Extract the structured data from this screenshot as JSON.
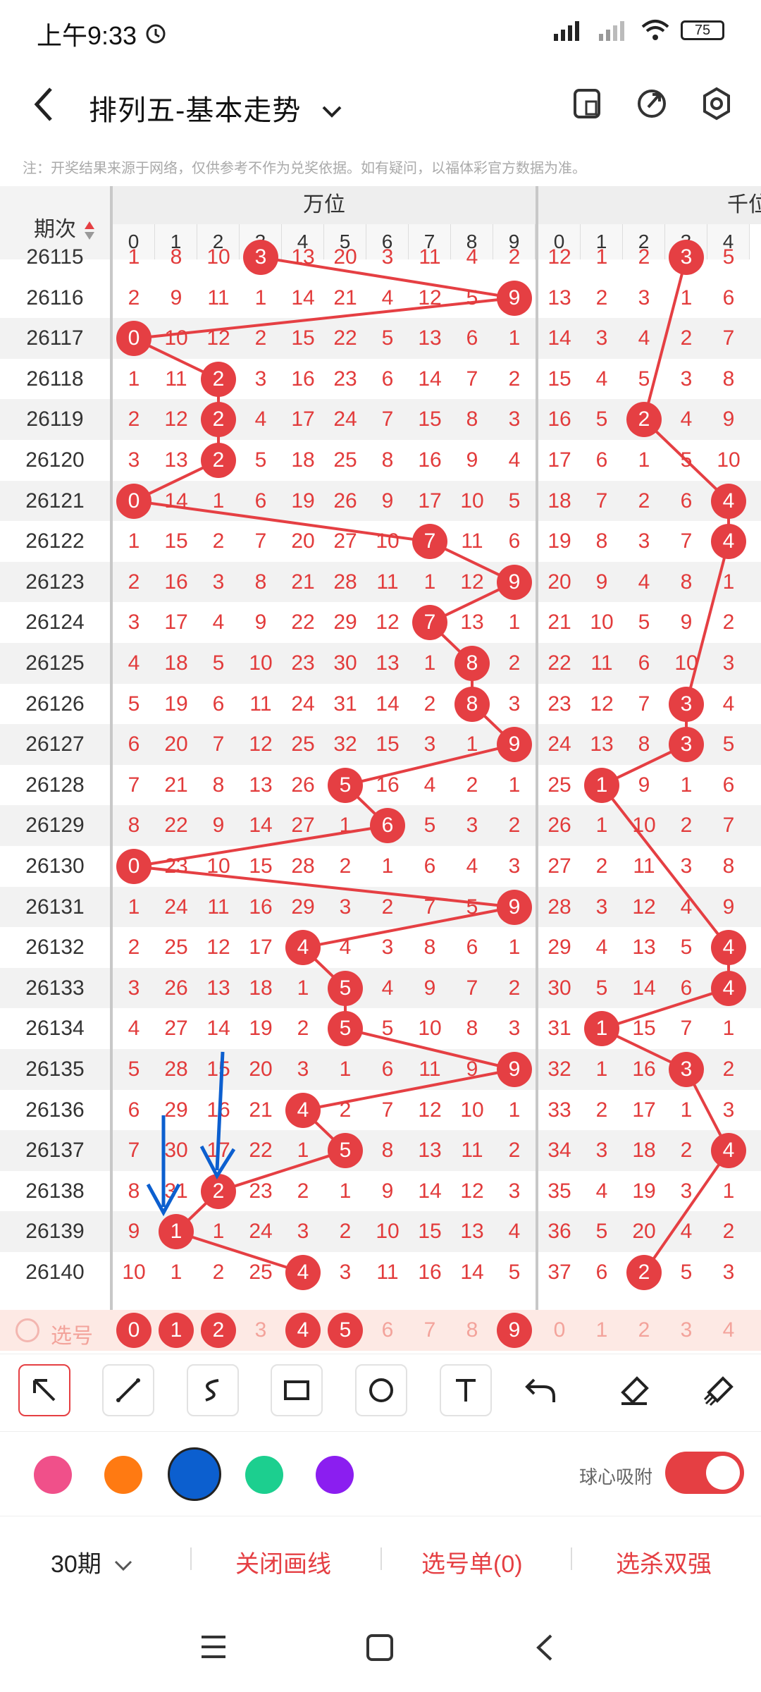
{
  "status_bar": {
    "time": "上午9:33",
    "battery": "75"
  },
  "header": {
    "title": "排列五-基本走势"
  },
  "note": "注：开奖结果来源于网络，仅供参考不作为兑奖依据。如有疑问，以福体彩官方数据为准。",
  "table": {
    "col_period": "期次",
    "group_wan": "万位",
    "group_qian": "千位",
    "digits": [
      "0",
      "1",
      "2",
      "3",
      "4",
      "5",
      "6",
      "7",
      "8",
      "9"
    ],
    "qian_digits": [
      "0",
      "1",
      "2",
      "3",
      "4"
    ],
    "rows": [
      {
        "period": "26115",
        "wan": [
          "1",
          "8",
          "10",
          "3",
          "13",
          "20",
          "3",
          "11",
          "4",
          "2"
        ],
        "wan_hit": 3,
        "qian": [
          "12",
          "1",
          "2",
          "3",
          "5"
        ],
        "qian_hit": 3
      },
      {
        "period": "26116",
        "wan": [
          "2",
          "9",
          "11",
          "1",
          "14",
          "21",
          "4",
          "12",
          "5",
          "9"
        ],
        "wan_hit": 9,
        "qian": [
          "13",
          "2",
          "3",
          "1",
          "6"
        ],
        "qian_hit": -1
      },
      {
        "period": "26117",
        "wan": [
          "0",
          "10",
          "12",
          "2",
          "15",
          "22",
          "5",
          "13",
          "6",
          "1"
        ],
        "wan_hit": 0,
        "qian": [
          "14",
          "3",
          "4",
          "2",
          "7"
        ],
        "qian_hit": -1
      },
      {
        "period": "26118",
        "wan": [
          "1",
          "11",
          "2",
          "3",
          "16",
          "23",
          "6",
          "14",
          "7",
          "2"
        ],
        "wan_hit": 2,
        "qian": [
          "15",
          "4",
          "5",
          "3",
          "8"
        ],
        "qian_hit": -1
      },
      {
        "period": "26119",
        "wan": [
          "2",
          "12",
          "2",
          "4",
          "17",
          "24",
          "7",
          "15",
          "8",
          "3"
        ],
        "wan_hit": 2,
        "qian": [
          "16",
          "5",
          "2",
          "4",
          "9"
        ],
        "qian_hit": 2
      },
      {
        "period": "26120",
        "wan": [
          "3",
          "13",
          "2",
          "5",
          "18",
          "25",
          "8",
          "16",
          "9",
          "4"
        ],
        "wan_hit": 2,
        "qian": [
          "17",
          "6",
          "1",
          "5",
          "10"
        ],
        "qian_hit": -1
      },
      {
        "period": "26121",
        "wan": [
          "0",
          "14",
          "1",
          "6",
          "19",
          "26",
          "9",
          "17",
          "10",
          "5"
        ],
        "wan_hit": 0,
        "qian": [
          "18",
          "7",
          "2",
          "6",
          "4"
        ],
        "qian_hit": 4
      },
      {
        "period": "26122",
        "wan": [
          "1",
          "15",
          "2",
          "7",
          "20",
          "27",
          "10",
          "7",
          "11",
          "6"
        ],
        "wan_hit": 7,
        "qian": [
          "19",
          "8",
          "3",
          "7",
          "4"
        ],
        "qian_hit": 4
      },
      {
        "period": "26123",
        "wan": [
          "2",
          "16",
          "3",
          "8",
          "21",
          "28",
          "11",
          "1",
          "12",
          "9"
        ],
        "wan_hit": 9,
        "qian": [
          "20",
          "9",
          "4",
          "8",
          "1"
        ],
        "qian_hit": -1
      },
      {
        "period": "26124",
        "wan": [
          "3",
          "17",
          "4",
          "9",
          "22",
          "29",
          "12",
          "7",
          "13",
          "1"
        ],
        "wan_hit": 7,
        "qian": [
          "21",
          "10",
          "5",
          "9",
          "2"
        ],
        "qian_hit": -1
      },
      {
        "period": "26125",
        "wan": [
          "4",
          "18",
          "5",
          "10",
          "23",
          "30",
          "13",
          "1",
          "8",
          "2"
        ],
        "wan_hit": 8,
        "qian": [
          "22",
          "11",
          "6",
          "10",
          "3"
        ],
        "qian_hit": -1
      },
      {
        "period": "26126",
        "wan": [
          "5",
          "19",
          "6",
          "11",
          "24",
          "31",
          "14",
          "2",
          "8",
          "3"
        ],
        "wan_hit": 8,
        "qian": [
          "23",
          "12",
          "7",
          "3",
          "4"
        ],
        "qian_hit": 3
      },
      {
        "period": "26127",
        "wan": [
          "6",
          "20",
          "7",
          "12",
          "25",
          "32",
          "15",
          "3",
          "1",
          "9"
        ],
        "wan_hit": 9,
        "qian": [
          "24",
          "13",
          "8",
          "3",
          "5"
        ],
        "qian_hit": 3
      },
      {
        "period": "26128",
        "wan": [
          "7",
          "21",
          "8",
          "13",
          "26",
          "5",
          "16",
          "4",
          "2",
          "1"
        ],
        "wan_hit": 5,
        "qian": [
          "25",
          "1",
          "9",
          "1",
          "6"
        ],
        "qian_hit": 1
      },
      {
        "period": "26129",
        "wan": [
          "8",
          "22",
          "9",
          "14",
          "27",
          "1",
          "6",
          "5",
          "3",
          "2"
        ],
        "wan_hit": 6,
        "qian": [
          "26",
          "1",
          "10",
          "2",
          "7"
        ],
        "qian_hit": -1
      },
      {
        "period": "26130",
        "wan": [
          "0",
          "23",
          "10",
          "15",
          "28",
          "2",
          "1",
          "6",
          "4",
          "3"
        ],
        "wan_hit": 0,
        "qian": [
          "27",
          "2",
          "11",
          "3",
          "8"
        ],
        "qian_hit": -1
      },
      {
        "period": "26131",
        "wan": [
          "1",
          "24",
          "11",
          "16",
          "29",
          "3",
          "2",
          "7",
          "5",
          "9"
        ],
        "wan_hit": 9,
        "qian": [
          "28",
          "3",
          "12",
          "4",
          "9"
        ],
        "qian_hit": -1
      },
      {
        "period": "26132",
        "wan": [
          "2",
          "25",
          "12",
          "17",
          "4",
          "4",
          "3",
          "8",
          "6",
          "1"
        ],
        "wan_hit": 4,
        "qian": [
          "29",
          "4",
          "13",
          "5",
          "4"
        ],
        "qian_hit": 4
      },
      {
        "period": "26133",
        "wan": [
          "3",
          "26",
          "13",
          "18",
          "1",
          "5",
          "4",
          "9",
          "7",
          "2"
        ],
        "wan_hit": 5,
        "qian": [
          "30",
          "5",
          "14",
          "6",
          "4"
        ],
        "qian_hit": 4
      },
      {
        "period": "26134",
        "wan": [
          "4",
          "27",
          "14",
          "19",
          "2",
          "5",
          "5",
          "10",
          "8",
          "3"
        ],
        "wan_hit": 5,
        "qian": [
          "31",
          "1",
          "15",
          "7",
          "1"
        ],
        "qian_hit": 1
      },
      {
        "period": "26135",
        "wan": [
          "5",
          "28",
          "15",
          "20",
          "3",
          "1",
          "6",
          "11",
          "9",
          "9"
        ],
        "wan_hit": 9,
        "qian": [
          "32",
          "1",
          "16",
          "3",
          "2"
        ],
        "qian_hit": 3
      },
      {
        "period": "26136",
        "wan": [
          "6",
          "29",
          "16",
          "21",
          "4",
          "2",
          "7",
          "12",
          "10",
          "1"
        ],
        "wan_hit": 4,
        "qian": [
          "33",
          "2",
          "17",
          "1",
          "3"
        ],
        "qian_hit": -1
      },
      {
        "period": "26137",
        "wan": [
          "7",
          "30",
          "17",
          "22",
          "1",
          "5",
          "8",
          "13",
          "11",
          "2"
        ],
        "wan_hit": 5,
        "qian": [
          "34",
          "3",
          "18",
          "2",
          "4"
        ],
        "qian_hit": 4
      },
      {
        "period": "26138",
        "wan": [
          "8",
          "31",
          "2",
          "23",
          "2",
          "1",
          "9",
          "14",
          "12",
          "3"
        ],
        "wan_hit": 2,
        "qian": [
          "35",
          "4",
          "19",
          "3",
          "1"
        ],
        "qian_hit": -1
      },
      {
        "period": "26139",
        "wan": [
          "9",
          "1",
          "1",
          "24",
          "3",
          "2",
          "10",
          "15",
          "13",
          "4"
        ],
        "wan_hit": 1,
        "qian": [
          "36",
          "5",
          "20",
          "4",
          "2"
        ],
        "qian_hit": -1
      },
      {
        "period": "26140",
        "wan": [
          "10",
          "1",
          "2",
          "25",
          "4",
          "3",
          "11",
          "16",
          "14",
          "5"
        ],
        "wan_hit": 4,
        "qian": [
          "37",
          "6",
          "2",
          "5",
          "3"
        ],
        "qian_hit": 2
      }
    ],
    "select_label": "选号",
    "select_wan": [
      "0",
      "1",
      "2",
      "3",
      "4",
      "5",
      "6",
      "7",
      "8",
      "9"
    ],
    "select_wan_active": [
      0,
      1,
      2,
      4,
      5,
      9
    ],
    "select_qian": [
      "0",
      "1",
      "2",
      "3",
      "4"
    ]
  },
  "colors": {
    "accent": "#e53f43",
    "pink": "#f0508a",
    "orange": "#ff7a12",
    "blue": "#0c5fcf",
    "green": "#1ccf8f",
    "purple": "#8b1ef0"
  },
  "toolbar": {
    "snap_label": "球心吸附"
  },
  "bottom": {
    "period_select": "30期",
    "close_lines": "关闭画线",
    "selection": "选号单(0)",
    "pick": "选杀双强"
  }
}
